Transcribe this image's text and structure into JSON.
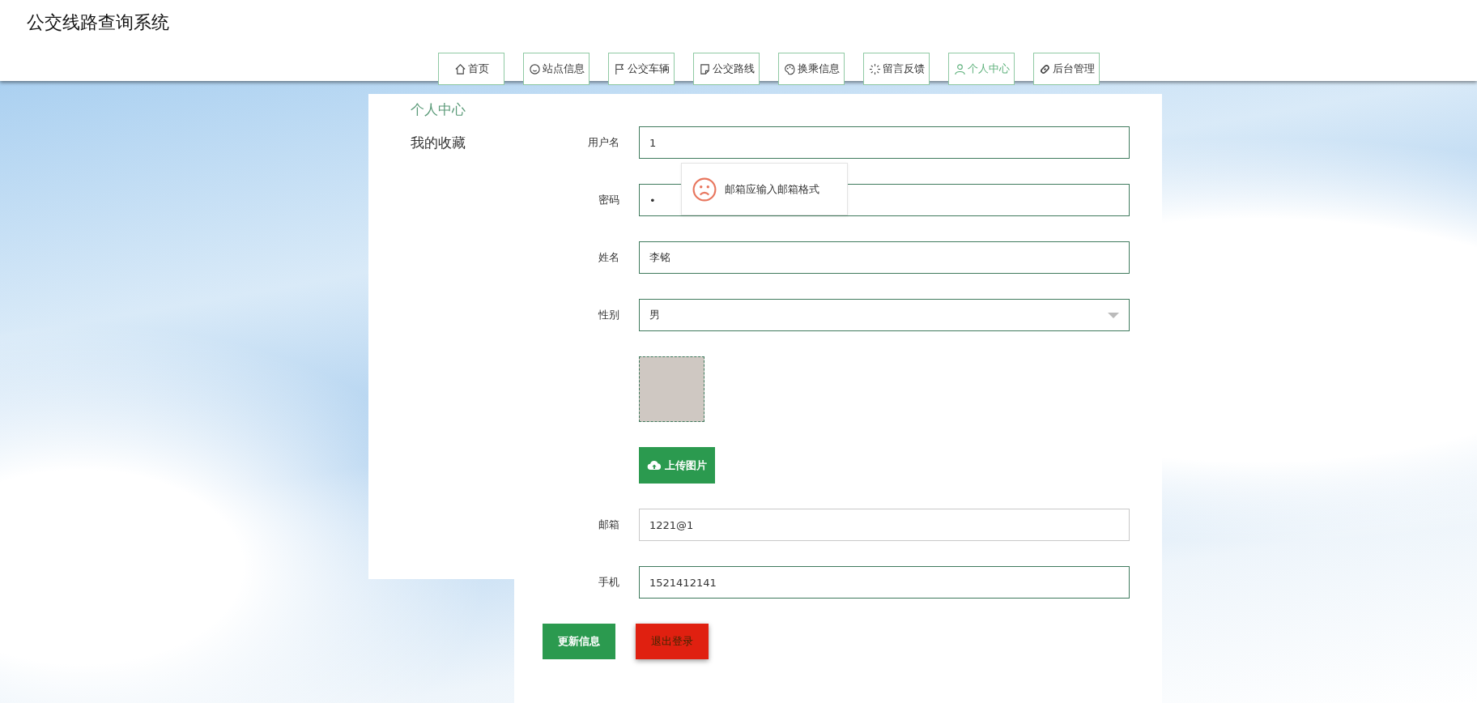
{
  "header": {
    "title": "公交线路查询系统"
  },
  "nav": [
    {
      "label": "首页",
      "kind": "home",
      "selected": false
    },
    {
      "label": "站点信息",
      "kind": "smile",
      "selected": false
    },
    {
      "label": "公交车辆",
      "kind": "flag",
      "selected": false
    },
    {
      "label": "公交路线",
      "kind": "note",
      "selected": false
    },
    {
      "label": "换乘信息",
      "kind": "palette",
      "selected": false
    },
    {
      "label": "留言反馈",
      "kind": "spinner",
      "selected": false
    },
    {
      "label": "个人中心",
      "kind": "user",
      "selected": true
    },
    {
      "label": "后台管理",
      "kind": "link",
      "selected": false
    }
  ],
  "sidebar": {
    "items": [
      {
        "label": "个人中心",
        "selected": true
      },
      {
        "label": "我的收藏",
        "selected": false
      }
    ]
  },
  "form": {
    "fields": [
      {
        "kind": "text",
        "label": "用户名",
        "value": "1",
        "focused": false
      },
      {
        "kind": "text",
        "label": "密码",
        "value": "•",
        "focused": false
      },
      {
        "kind": "text",
        "label": "姓名",
        "value": "李铭",
        "focused": false
      },
      {
        "kind": "select",
        "label": "性别",
        "value": "男",
        "focused": false
      },
      {
        "kind": "image"
      },
      {
        "kind": "upload",
        "button": "上传图片"
      },
      {
        "kind": "text",
        "label": "邮箱",
        "value": "1221@1",
        "focused": true
      },
      {
        "kind": "text",
        "label": "手机",
        "value": "1521412141",
        "focused": false
      }
    ],
    "buttons": [
      {
        "label": "更新信息",
        "kind": "primary"
      },
      {
        "label": "退出登录",
        "kind": "danger"
      }
    ]
  },
  "tooltip": {
    "text": "邮箱应输入邮箱格式"
  }
}
